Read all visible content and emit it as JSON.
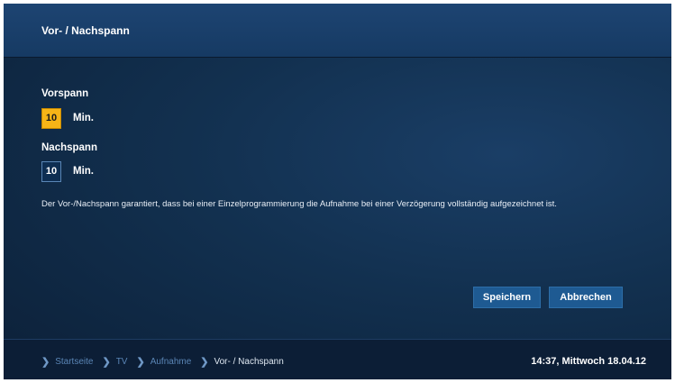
{
  "header": {
    "title": "Vor- / Nachspann"
  },
  "vorspann": {
    "label": "Vorspann",
    "value": "10",
    "unit": "Min."
  },
  "nachspann": {
    "label": "Nachspann",
    "value": "10",
    "unit": "Min."
  },
  "description": "Der Vor-/Nachspann garantiert, dass bei einer Einzelprogrammierung die Aufnahme bei einer Verzögerung vollständig aufgezeichnet ist.",
  "buttons": {
    "save_label": "Speichern",
    "cancel_label": "Abbrechen"
  },
  "footer": {
    "breadcrumb": [
      "Startseite",
      "TV",
      "Aufnahme",
      "Vor- / Nachspann"
    ],
    "clock": "14:37, Mittwoch 18.04.12"
  },
  "colors": {
    "focus": "#f6b417",
    "button": "#1e5a92",
    "background": "#12304f"
  },
  "icons": {
    "breadcrumb_separator": "chevron-right-icon"
  }
}
